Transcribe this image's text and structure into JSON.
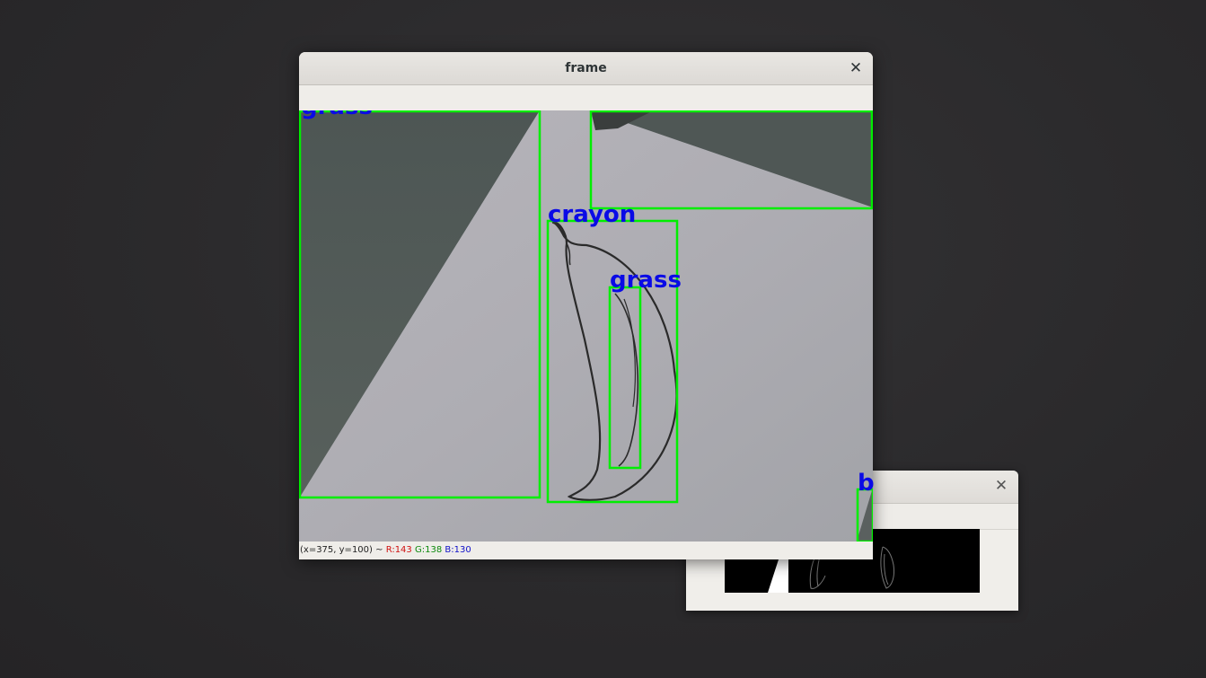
{
  "windows": {
    "frame": {
      "title": "frame",
      "close_glyph": "✕",
      "status": {
        "coords": "(x=375, y=100) ~",
        "r": "R:143",
        "g": "G:138",
        "b": "B:130"
      },
      "detections": [
        {
          "label": "grass",
          "color": "#00ee00"
        },
        {
          "label": "crayon",
          "color": "#00ee00"
        },
        {
          "label": "grass",
          "color": "#00ee00"
        },
        {
          "label": "",
          "color": "#00ee00"
        },
        {
          "label": "b",
          "color": "#00ee00"
        }
      ],
      "label_color": "#0a0ae6"
    },
    "edges_preview": {
      "title": "",
      "close_glyph": "✕"
    }
  },
  "icons": {
    "close": "close-icon"
  }
}
